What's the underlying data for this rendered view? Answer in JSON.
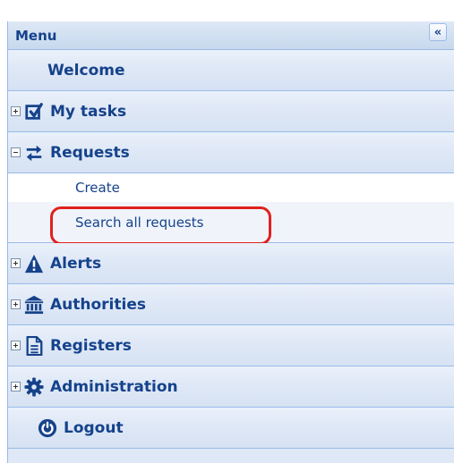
{
  "panel": {
    "title": "Menu",
    "collapse_label": "«",
    "items": [
      {
        "label": "Welcome",
        "icon": null
      },
      {
        "label": "My tasks",
        "icon": "checkbox-icon",
        "state": "collapsed"
      },
      {
        "label": "Requests",
        "icon": "swap-arrows-icon",
        "state": "expanded",
        "children": [
          {
            "label": "Create"
          },
          {
            "label": "Search all requests",
            "highlighted": true
          }
        ]
      },
      {
        "label": "Alerts",
        "icon": "warning-icon",
        "state": "collapsed"
      },
      {
        "label": "Authorities",
        "icon": "institution-icon",
        "state": "collapsed"
      },
      {
        "label": "Registers",
        "icon": "document-icon",
        "state": "collapsed"
      },
      {
        "label": "Administration",
        "icon": "gear-icon",
        "state": "collapsed"
      },
      {
        "label": "Logout",
        "icon": "power-icon"
      }
    ]
  },
  "colors": {
    "accent_text": "#15428b",
    "border": "#99bbe8",
    "highlight": "#e0201d"
  }
}
